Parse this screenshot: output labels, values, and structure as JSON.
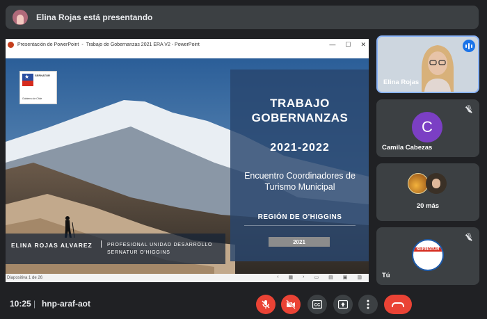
{
  "banner": {
    "text": "Elina Rojas está presentando"
  },
  "window": {
    "app": "Presentación de PowerPoint",
    "separator": "-",
    "title": "Trabajo de Gobernanzas 2021 ERA V2 - PowerPoint",
    "status": "Diapositiva 1 de 26"
  },
  "slide": {
    "logo_title": "SERNATUR",
    "logo_footer": "Gobierno de Chile",
    "title_line1": "TRABAJO",
    "title_line2": "GOBERNANZAS",
    "years": "2021-2022",
    "subtitle_line1": "Encuentro Coordinadores de",
    "subtitle_line2": "Turismo Municipal",
    "region": "REGIÓN DE O'HIGGINS",
    "year_box": "2021",
    "presenter_name": "ELINA ROJAS ALVAREZ",
    "presenter_sep": "|",
    "presenter_role_line1": "PROFESIONAL UNIDAD DESARROLLO",
    "presenter_role_line2": "SERNATUR O'HIGGINS"
  },
  "participants": [
    {
      "name": "Elina Rojas",
      "speaking": true
    },
    {
      "name": "Camila Cabezas",
      "initial": "C",
      "avatar_color": "#7b3fc4",
      "muted": true
    },
    {
      "label": "20 más"
    },
    {
      "name": "Tú",
      "muted": true,
      "avatar_text": "SERNATUR"
    }
  ],
  "footer": {
    "time": "10:25",
    "separator": "|",
    "meeting_code": "hnp-araf-aot"
  },
  "colors": {
    "accent": "#8ab4f8",
    "danger": "#ea4335",
    "background": "#202124",
    "tile": "#3c4043"
  }
}
